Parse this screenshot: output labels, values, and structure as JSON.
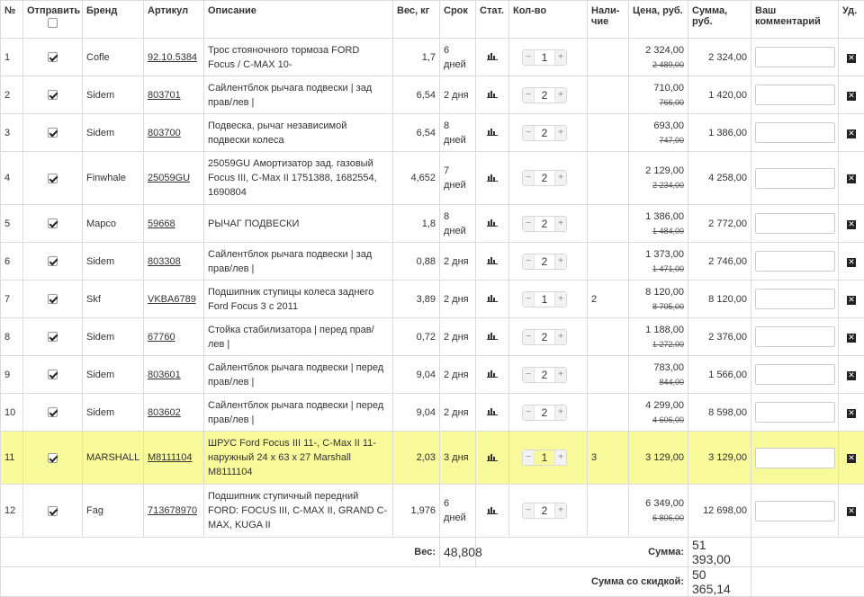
{
  "headers": {
    "num": "№",
    "send": "Отправить",
    "brand": "Бренд",
    "article": "Артикул",
    "description": "Описание",
    "weight": "Вес, кг",
    "term": "Срок",
    "stat": "Стат.",
    "qty": "Кол-во",
    "avail": "Нали-чие",
    "price": "Цена, руб.",
    "sum": "Сумма, руб.",
    "comment": "Ваш комментарий",
    "del": "Уд."
  },
  "rows": [
    {
      "n": "1",
      "brand": "Cofle",
      "article": "92.10.5384",
      "desc": "Трос стояночного тормоза FORD Focus / C-MAX 10-",
      "weight": "1,7",
      "term": "6 дней",
      "qty": "1",
      "avail": "",
      "price": "2 324,00",
      "old_price": "2 489,00",
      "sum": "2 324,00",
      "checked": true
    },
    {
      "n": "2",
      "brand": "Sidem",
      "article": "803701",
      "desc": "Сайлентблок рычага подвески | зад прав/лев |",
      "weight": "6,54",
      "term": "2 дня",
      "qty": "2",
      "avail": "",
      "price": "710,00",
      "old_price": "766,00",
      "sum": "1 420,00",
      "checked": true
    },
    {
      "n": "3",
      "brand": "Sidem",
      "article": "803700",
      "desc": "Подвеска, рычаг независимой подвески колеса",
      "weight": "6,54",
      "term": "8 дней",
      "qty": "2",
      "avail": "",
      "price": "693,00",
      "old_price": "747,00",
      "sum": "1 386,00",
      "checked": true
    },
    {
      "n": "4",
      "brand": "Finwhale",
      "article": "25059GU",
      "desc": "25059GU Амортизатор зад. газовый Focus III, C-Max II 1751388, 1682554, 1690804",
      "weight": "4,652",
      "term": "7 дней",
      "qty": "2",
      "avail": "",
      "price": "2 129,00",
      "old_price": "2 234,00",
      "sum": "4 258,00",
      "checked": true
    },
    {
      "n": "5",
      "brand": "Mapco",
      "article": "59668",
      "desc": "РЫЧАГ ПОДВЕСКИ",
      "weight": "1,8",
      "term": "8 дней",
      "qty": "2",
      "avail": "",
      "price": "1 386,00",
      "old_price": "1 484,00",
      "sum": "2 772,00",
      "checked": true
    },
    {
      "n": "6",
      "brand": "Sidem",
      "article": "803308",
      "desc": "Сайлентблок рычага подвески | зад прав/лев |",
      "weight": "0,88",
      "term": "2 дня",
      "qty": "2",
      "avail": "",
      "price": "1 373,00",
      "old_price": "1 471,00",
      "sum": "2 746,00",
      "checked": true
    },
    {
      "n": "7",
      "brand": "Skf",
      "article": "VKBA6789",
      "desc": "Подшипник ступицы колеса заднего Ford Focus 3 с 2011",
      "weight": "3,89",
      "term": "2 дня",
      "qty": "1",
      "avail": "2",
      "price": "8 120,00",
      "old_price": "8 705,00",
      "sum": "8 120,00",
      "checked": true
    },
    {
      "n": "8",
      "brand": "Sidem",
      "article": "67760",
      "desc": "Стойка стабилизатора | перед прав/лев |",
      "weight": "0,72",
      "term": "2 дня",
      "qty": "2",
      "avail": "",
      "price": "1 188,00",
      "old_price": "1 272,00",
      "sum": "2 376,00",
      "checked": true
    },
    {
      "n": "9",
      "brand": "Sidem",
      "article": "803601",
      "desc": "Сайлентблок рычага подвески | перед прав/лев |",
      "weight": "9,04",
      "term": "2 дня",
      "qty": "2",
      "avail": "",
      "price": "783,00",
      "old_price": "844,00",
      "sum": "1 566,00",
      "checked": true
    },
    {
      "n": "10",
      "brand": "Sidem",
      "article": "803602",
      "desc": "Сайлентблок рычага подвески | перед прав/лев |",
      "weight": "9,04",
      "term": "2 дня",
      "qty": "2",
      "avail": "",
      "price": "4 299,00",
      "old_price": "4 606,00",
      "sum": "8 598,00",
      "checked": true
    },
    {
      "n": "11",
      "brand": "MARSHALL",
      "article": "M8111104",
      "desc": "ШРУС Ford Focus III 11-, C-Max II 11- наружный 24 x 63 x 27 Marshall M8111104",
      "weight": "2,03",
      "term": "3 дня",
      "qty": "1",
      "avail": "3",
      "price": "3 129,00",
      "old_price": "",
      "sum": "3 129,00",
      "checked": true
    },
    {
      "n": "12",
      "brand": "Fag",
      "article": "713678970",
      "desc": "Подшипник ступичный передний FORD: FOCUS III, C-MAX II, GRAND C-MAX, KUGA II",
      "weight": "1,976",
      "term": "6 дней",
      "qty": "2",
      "avail": "",
      "price": "6 349,00",
      "old_price": "6 806,00",
      "sum": "12 698,00",
      "checked": true
    }
  ],
  "totals": {
    "weight_label": "Вес:",
    "weight_value": "48,808",
    "sum_label": "Сумма:",
    "sum_value": "51 393,00",
    "discount_label": "Сумма со скидкой:",
    "discount_value": "50 365,14"
  },
  "icons": {
    "stat": "bar-chart-icon",
    "delete": "delete-icon",
    "minus": "minus",
    "plus": "plus"
  },
  "colors": {
    "highlight_row": "#f8f99a",
    "border": "#dcdcdc"
  },
  "highlighted_row": "11"
}
